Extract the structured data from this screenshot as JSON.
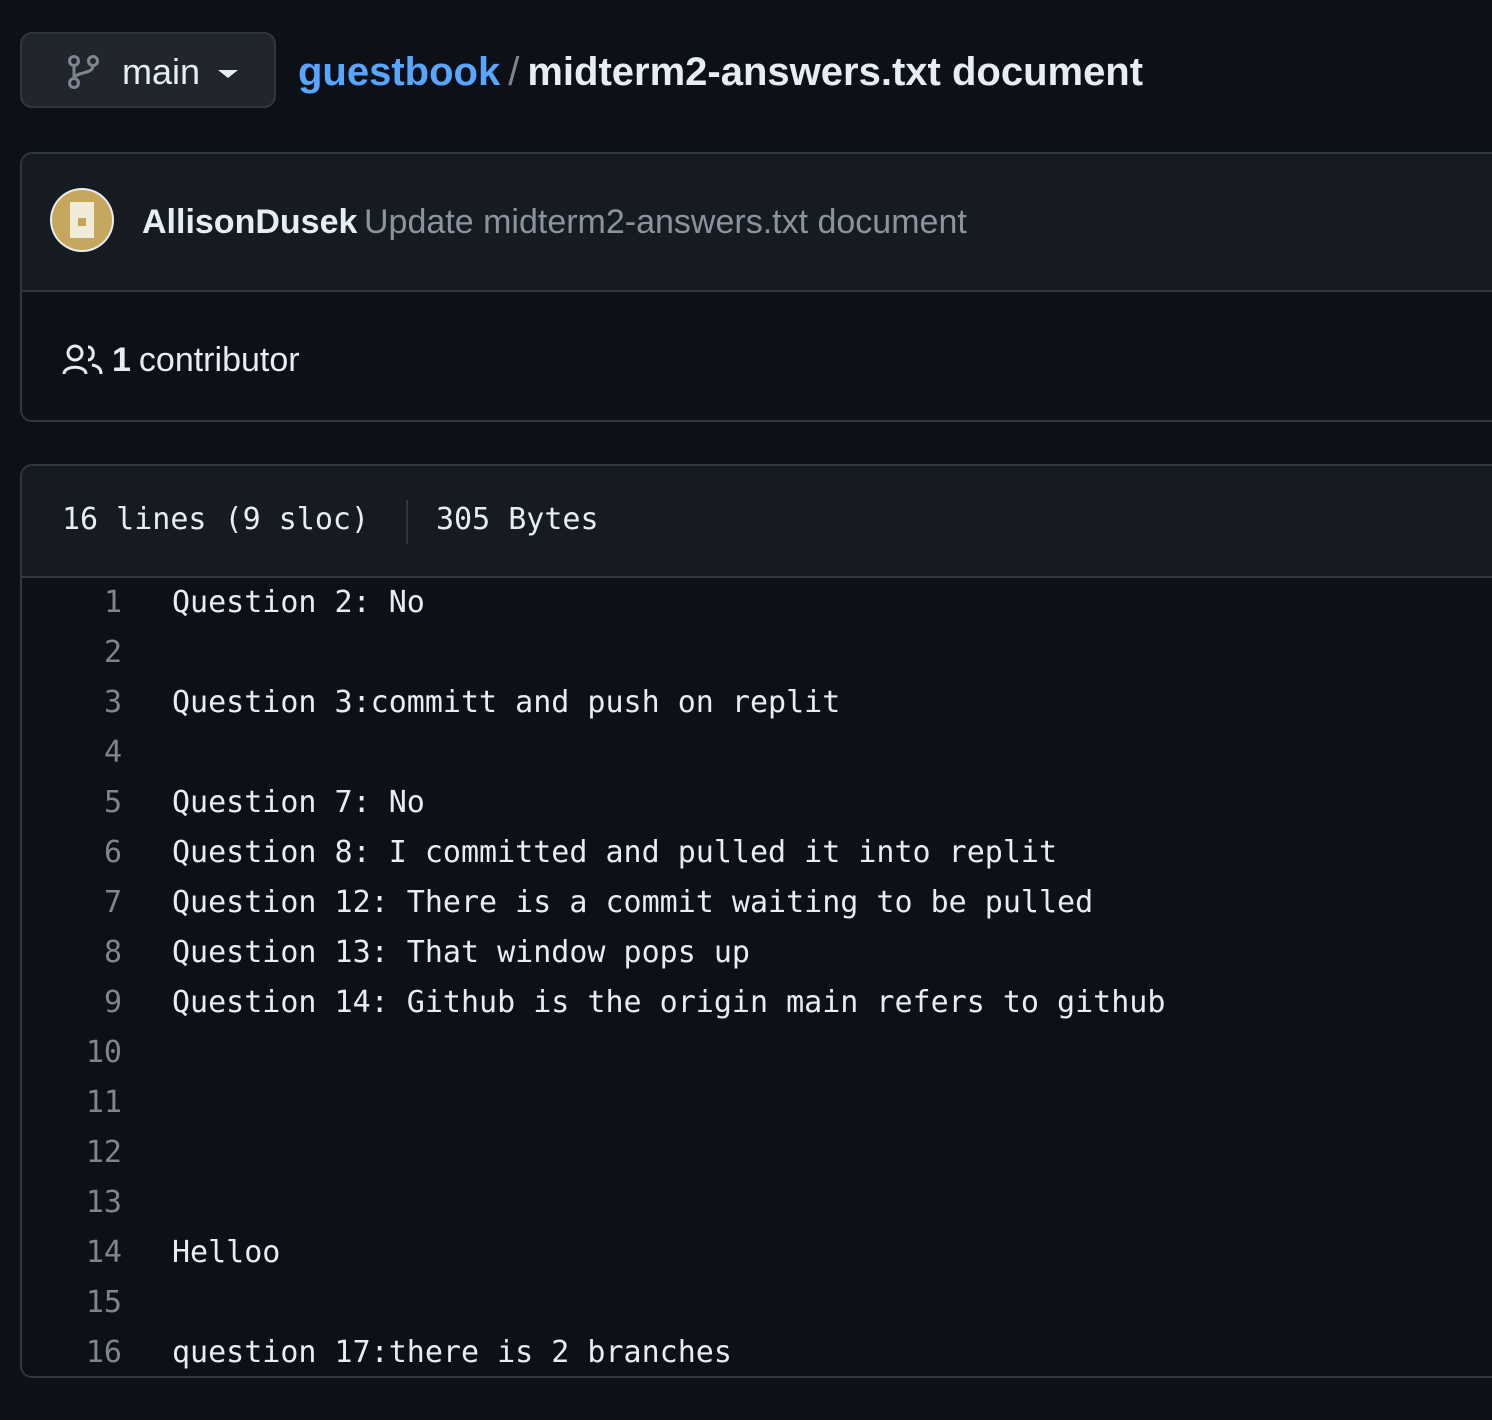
{
  "branch": {
    "label": "main"
  },
  "breadcrumb": {
    "repo": "guestbook",
    "separator": "/",
    "file": "midterm2-answers.txt document"
  },
  "commit": {
    "author": "AllisonDusek",
    "message": "Update midterm2-answers.txt document"
  },
  "contributors": {
    "count": "1",
    "label": "contributor"
  },
  "file_info": {
    "lines": "16 lines (9 sloc)",
    "size": "305 Bytes"
  },
  "code_lines": [
    {
      "num": "1",
      "text": "Question 2: No"
    },
    {
      "num": "2",
      "text": ""
    },
    {
      "num": "3",
      "text": "Question 3:committ and push on replit"
    },
    {
      "num": "4",
      "text": ""
    },
    {
      "num": "5",
      "text": "Question 7: No"
    },
    {
      "num": "6",
      "text": "Question 8: I committed and pulled it into replit"
    },
    {
      "num": "7",
      "text": "Question 12: There is a commit waiting to be pulled"
    },
    {
      "num": "8",
      "text": "Question 13: That window pops up"
    },
    {
      "num": "9",
      "text": "Question 14: Github is the origin main refers to github"
    },
    {
      "num": "10",
      "text": ""
    },
    {
      "num": "11",
      "text": ""
    },
    {
      "num": "12",
      "text": ""
    },
    {
      "num": "13",
      "text": ""
    },
    {
      "num": "14",
      "text": "Helloo"
    },
    {
      "num": "15",
      "text": ""
    },
    {
      "num": "16",
      "text": "question 17:there is 2 branches"
    }
  ],
  "colors": {
    "background": "#0d1117",
    "link": "#58a6ff",
    "border": "#30363d",
    "muted": "#7d8590"
  },
  "icons": {
    "branch": "git-branch-icon",
    "caret": "caret-down-icon",
    "avatar": "user-avatar",
    "people": "people-icon"
  }
}
